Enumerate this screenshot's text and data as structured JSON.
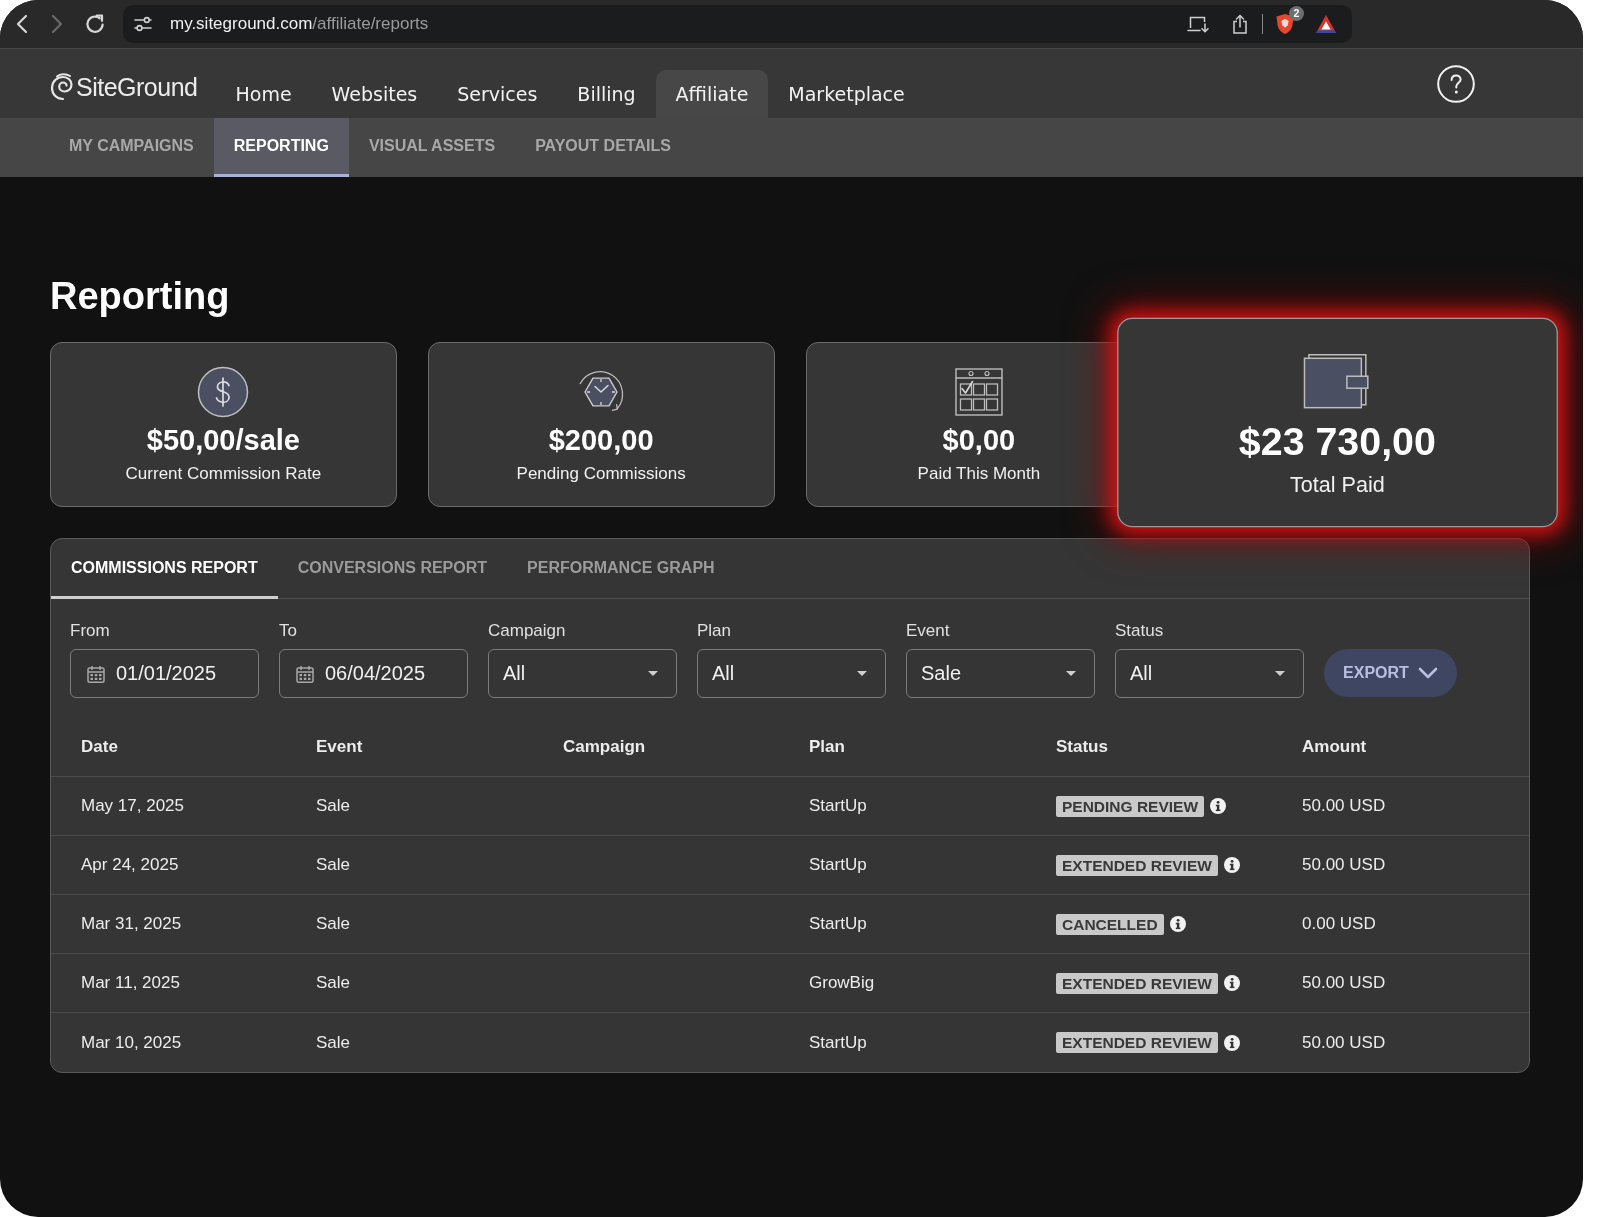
{
  "browser": {
    "can_go_forward": false,
    "address": {
      "host": "my.siteground.com",
      "path": "/affiliate/reports"
    },
    "shields_count": "2"
  },
  "nav": {
    "brand": "SiteGround",
    "items": [
      {
        "label": "Home",
        "selected": false
      },
      {
        "label": "Websites",
        "selected": false
      },
      {
        "label": "Services",
        "selected": false
      },
      {
        "label": "Billing",
        "selected": false
      },
      {
        "label": "Affiliate",
        "selected": true
      },
      {
        "label": "Marketplace",
        "selected": false
      }
    ]
  },
  "sub_nav": {
    "items": [
      {
        "label": "MY CAMPAIGNS",
        "selected": false
      },
      {
        "label": "REPORTING",
        "selected": true
      },
      {
        "label": "VISUAL ASSETS",
        "selected": false
      },
      {
        "label": "PAYOUT DETAILS",
        "selected": false
      }
    ]
  },
  "page_title": "Reporting",
  "stats": [
    {
      "kind": "coin",
      "value": "$50,00/sale",
      "label": "Current Commission Rate",
      "highlighted": false
    },
    {
      "kind": "clock",
      "value": "$200,00",
      "label": "Pending Commissions",
      "highlighted": false
    },
    {
      "kind": "calendar",
      "value": "$0,00",
      "label": "Paid This Month",
      "highlighted": false
    },
    {
      "kind": "wallet",
      "value": "$23 730,00",
      "label": "Total Paid",
      "highlighted": true
    }
  ],
  "report": {
    "tabs": [
      {
        "label": "COMMISSIONS REPORT",
        "selected": true
      },
      {
        "label": "CONVERSIONS REPORT",
        "selected": false
      },
      {
        "label": "PERFORMANCE GRAPH",
        "selected": false
      }
    ],
    "filters": [
      {
        "kind": "date",
        "label": "From",
        "value": "01/01/2025"
      },
      {
        "kind": "date",
        "label": "To",
        "value": "06/04/2025"
      },
      {
        "kind": "select",
        "label": "Campaign",
        "value": "All"
      },
      {
        "kind": "select",
        "label": "Plan",
        "value": "All"
      },
      {
        "kind": "select",
        "label": "Event",
        "value": "Sale"
      },
      {
        "kind": "select",
        "label": "Status",
        "value": "All"
      }
    ],
    "export_label": "EXPORT",
    "table": {
      "columns": [
        "Date",
        "Event",
        "Campaign",
        "Plan",
        "Status",
        "Amount"
      ],
      "rows": [
        {
          "date": "May 17, 2025",
          "event": "Sale",
          "plan": "StartUp",
          "status": "PENDING REVIEW",
          "amount": "50.00 USD"
        },
        {
          "date": "Apr 24, 2025",
          "event": "Sale",
          "plan": "StartUp",
          "status": "EXTENDED REVIEW",
          "amount": "50.00 USD"
        },
        {
          "date": "Mar 31, 2025",
          "event": "Sale",
          "plan": "StartUp",
          "status": "CANCELLED",
          "amount": "0.00 USD"
        },
        {
          "date": "Mar 11, 2025",
          "event": "Sale",
          "plan": "GrowBig",
          "status": "EXTENDED REVIEW",
          "amount": "50.00 USD"
        },
        {
          "date": "Mar 10, 2025",
          "event": "Sale",
          "plan": "StartUp",
          "status": "EXTENDED REVIEW",
          "amount": "50.00 USD"
        }
      ]
    }
  }
}
